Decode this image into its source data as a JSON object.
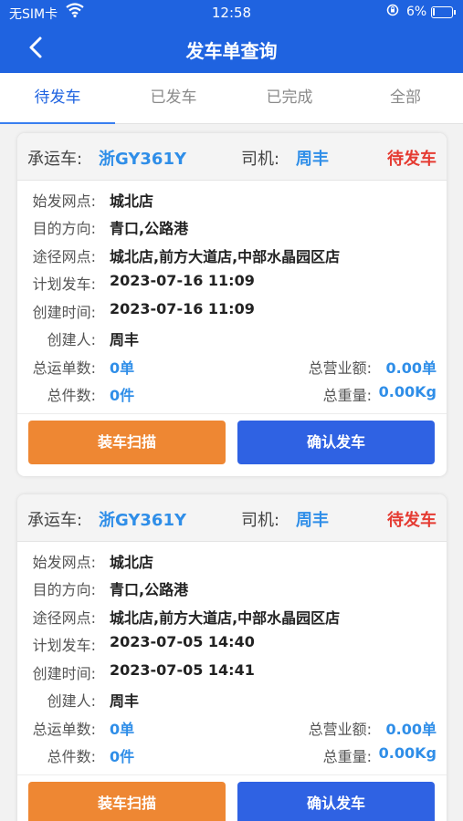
{
  "status_bar": {
    "carrier": "无SIM卡",
    "time": "12:58",
    "battery": "6%",
    "battery_level": 0.06
  },
  "header": {
    "title": "发车单查询"
  },
  "tabs": [
    {
      "label": "待发车",
      "active": true
    },
    {
      "label": "已发车",
      "active": false
    },
    {
      "label": "已完成",
      "active": false
    },
    {
      "label": "全部",
      "active": false
    }
  ],
  "labels": {
    "carrier": "承运车:",
    "driver": "司机:",
    "origin": "始发网点:",
    "direction": "目的方向:",
    "via": "途径网点:",
    "planned": "计划发车:",
    "created": "创建时间:",
    "creator": "创建人:",
    "total_orders": "总运单数:",
    "total_revenue": "总营业额:",
    "total_pieces": "总件数:",
    "total_weight": "总重量:"
  },
  "buttons": {
    "load_scan": "装车扫描",
    "confirm_depart": "确认发车"
  },
  "orders": [
    {
      "vehicle": "浙GY361Y",
      "driver": "周丰",
      "status": "待发车",
      "origin": "城北店",
      "direction": "青口,公路港",
      "via": "城北店,前方大道店,中部水晶园区店",
      "planned": "2023-07-16 11:09",
      "created": "2023-07-16 11:09",
      "creator": "周丰",
      "total_orders": "0单",
      "total_revenue": "0.00单",
      "total_pieces": "0件",
      "total_weight": "0.00Kg"
    },
    {
      "vehicle": "浙GY361Y",
      "driver": "周丰",
      "status": "待发车",
      "origin": "城北店",
      "direction": "青口,公路港",
      "via": "城北店,前方大道店,中部水晶园区店",
      "planned": "2023-07-05 14:40",
      "created": "2023-07-05 14:41",
      "creator": "周丰",
      "total_orders": "0单",
      "total_revenue": "0.00单",
      "total_pieces": "0件",
      "total_weight": "0.00Kg"
    }
  ]
}
